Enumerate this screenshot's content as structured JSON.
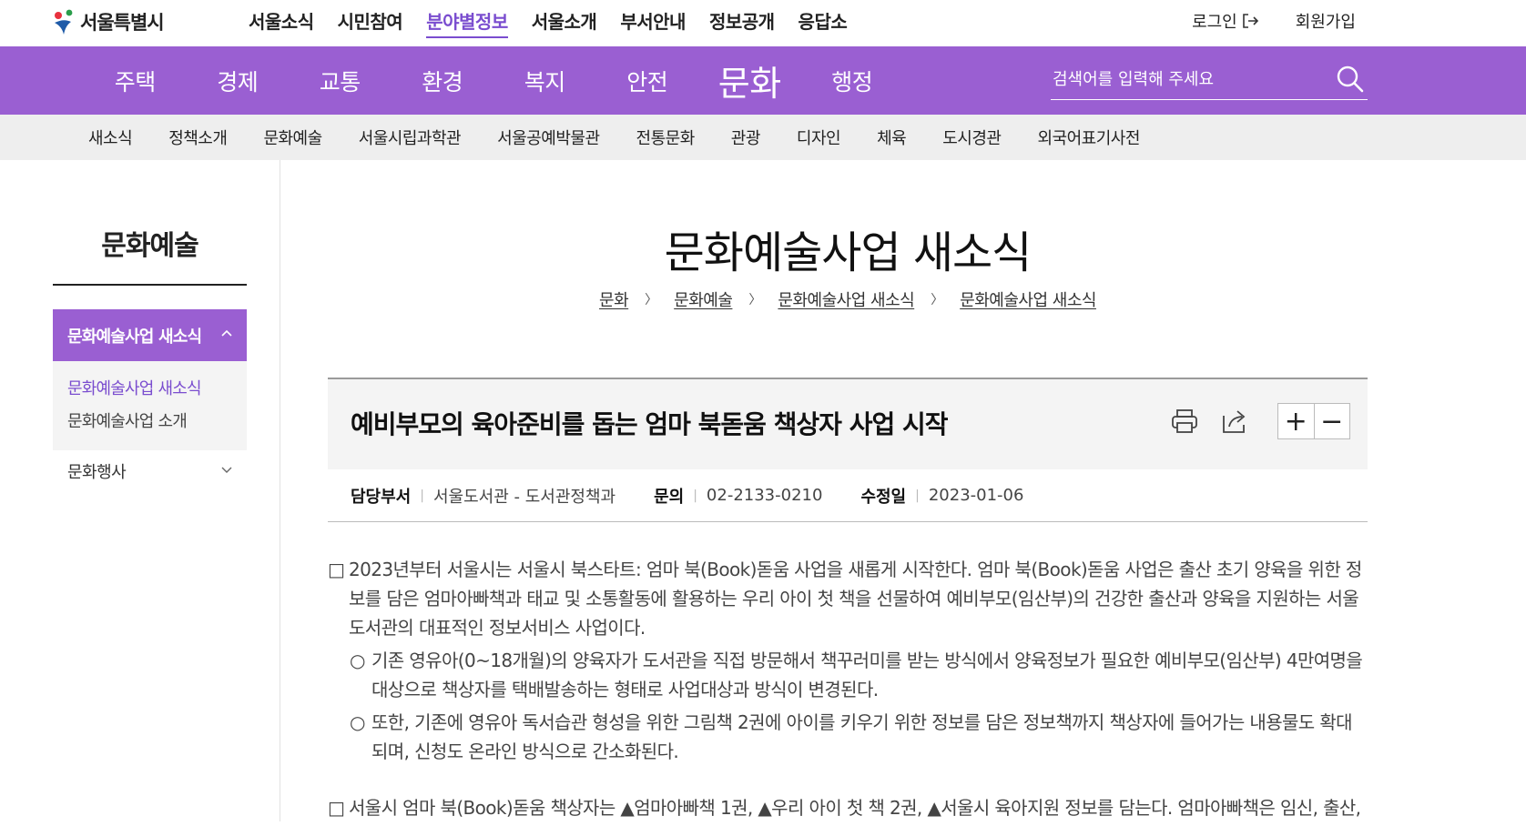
{
  "header": {
    "logo_text": "서울특별시",
    "gnb": [
      "서울소식",
      "시민참여",
      "분야별정보",
      "서울소개",
      "부서안내",
      "정보공개",
      "응답소"
    ],
    "gnb_active_index": 2,
    "login": "로그인",
    "signup": "회원가입"
  },
  "main_nav": {
    "items": [
      "주택",
      "경제",
      "교통",
      "환경",
      "복지",
      "안전",
      "문화",
      "행정"
    ],
    "current_index": 6,
    "search_placeholder": "검색어를 입력해 주세요"
  },
  "sub_nav": {
    "items": [
      "새소식",
      "정책소개",
      "문화예술",
      "서울시립과학관",
      "서울공예박물관",
      "전통문화",
      "관광",
      "디자인",
      "체육",
      "도시경관",
      "외국어표기사전"
    ]
  },
  "sidebar": {
    "title": "문화예술",
    "active_group": "문화예술사업 새소식",
    "sub_items": [
      "문화예술사업 새소식",
      "문화예술사업 소개"
    ],
    "other_group": "문화행사"
  },
  "page": {
    "title": "문화예술사업 새소식",
    "breadcrumb": [
      "문화",
      "문화예술",
      "문화예술사업 새소식",
      "문화예술사업 새소식"
    ]
  },
  "article": {
    "title": "예비부모의 육아준비를 돕는 엄마 북돋움 책상자 사업 시작",
    "zoom_in": "+",
    "zoom_out": "−",
    "meta": {
      "dept_label": "담당부서",
      "dept_value": "서울도서관 - 도서관정책과",
      "contact_label": "문의",
      "contact_value": "02-2133-0210",
      "modified_label": "수정일",
      "modified_value": "2023-01-06"
    },
    "body": {
      "p1_marker": "□",
      "p1": "2023년부터 서울시는 서울시 북스타트: 엄마 북(Book)돋움 사업을 새롭게 시작한다. 엄마 북(Book)돋움 사업은 출산 초기 양육을 위한 정보를 담은 엄마아빠책과 태교 및 소통활동에 활용하는 우리 아이 첫 책을 선물하여 예비부모(임산부)의 건강한 출산과 양육을 지원하는 서울도서관의 대표적인 정보서비스 사업이다.",
      "s1_marker": "○",
      "s1": "기존 영유아(0~18개월)의 양육자가 도서관을 직접 방문해서 책꾸러미를 받는 방식에서 양육정보가 필요한 예비부모(임산부) 4만여명을 대상으로 책상자를 택배발송하는 형태로 사업대상과 방식이 변경된다.",
      "s2_marker": "○",
      "s2": "또한, 기존에 영유아 독서습관 형성을 위한 그림책 2권에 아이를 키우기 위한 정보를 담은 정보책까지 책상자에 들어가는 내용물도 확대되며, 신청도 온라인 방식으로 간소화된다.",
      "p2_marker": "□",
      "p2": "서울시 엄마 북(Book)돋움 책상자는 ▲엄마아빠책 1권, ▲우리 아이 첫 책 2권, ▲서울시 육아지원 정보를 담는다. 엄마아빠책은 임신, 출산,"
    }
  },
  "colors": {
    "brand_purple": "#9a5fd2",
    "active_text": "#7a4dcf",
    "subnav_bg": "#eeeeee"
  },
  "icons": {
    "login": "logout-arrow-icon",
    "search": "search-icon",
    "print": "print-icon",
    "share": "share-icon",
    "chevron_up": "chevron-up-icon",
    "chevron_down": "chevron-down-icon"
  }
}
